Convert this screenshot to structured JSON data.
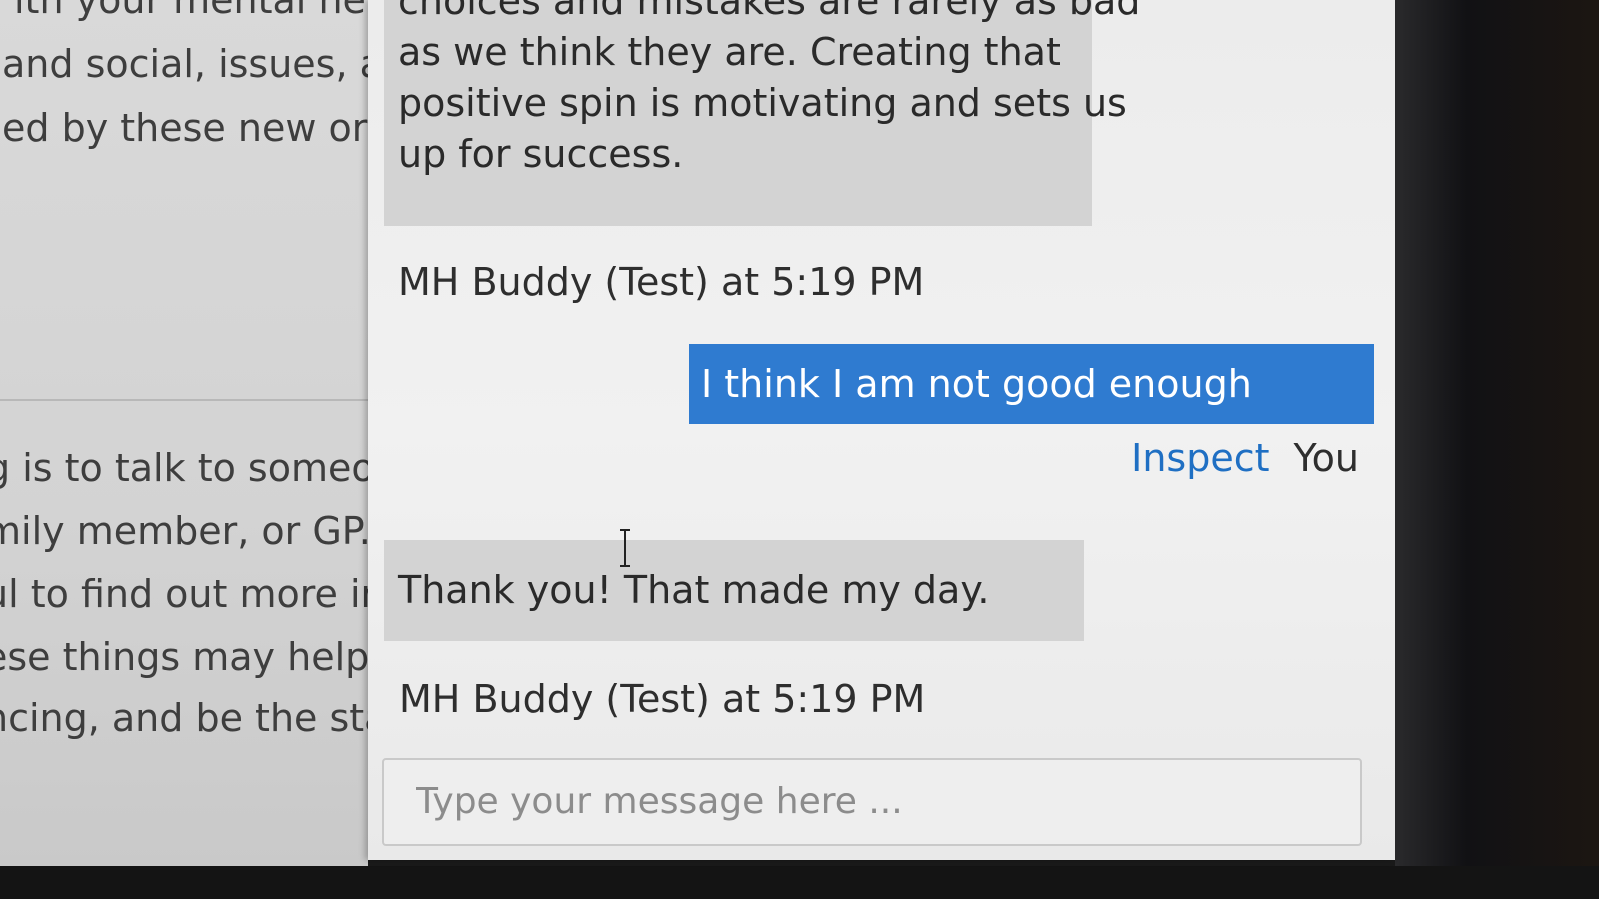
{
  "background_text": {
    "top_lines": [
      "ith your mental hea",
      "and social, issues, a",
      "ed by these new or"
    ],
    "bottom_lines": [
      "g is to talk to someo",
      "mily member, or GP.",
      "ul to find out more ir",
      "ese things may help",
      "ncing, and be the sta"
    ]
  },
  "chat": {
    "messages": [
      {
        "from": "bot",
        "lines": [
          "choices and mistakes are rarely as bad",
          "as we think they are. Creating that",
          "positive spin is motivating and sets us",
          "up for success."
        ]
      },
      {
        "from": "meta",
        "text": "MH Buddy (Test) at 5:19 PM"
      },
      {
        "from": "user",
        "text": "I think I am not good enough",
        "inspect_label": "Inspect",
        "sender_label": "You"
      },
      {
        "from": "bot",
        "lines": [
          "Thank you! That made my day."
        ]
      },
      {
        "from": "meta",
        "text": "MH Buddy (Test) at 5:19 PM"
      }
    ],
    "input": {
      "placeholder": "Type your message here ..."
    },
    "colors": {
      "user_bubble": "#2f7bd0",
      "bot_bubble": "#d3d3d3",
      "link": "#1f6fc3"
    }
  }
}
